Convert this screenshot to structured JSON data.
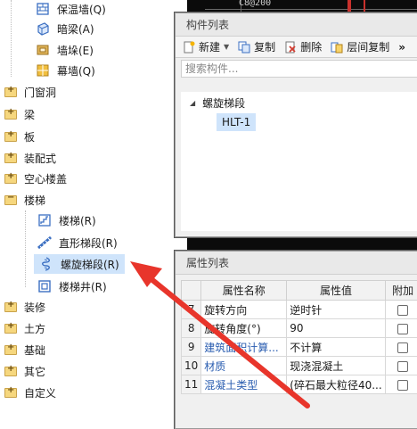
{
  "tree": {
    "items": [
      {
        "label": "保温墙(Q)",
        "kind": "child",
        "icon": "insulation-wall-icon"
      },
      {
        "label": "暗梁(A)",
        "kind": "child",
        "icon": "hidden-beam-icon"
      },
      {
        "label": "墙垛(E)",
        "kind": "child",
        "icon": "wall-pier-icon"
      },
      {
        "label": "幕墙(Q)",
        "kind": "child",
        "icon": "curtain-wall-icon"
      },
      {
        "label": "门窗洞",
        "kind": "folder"
      },
      {
        "label": "梁",
        "kind": "folder"
      },
      {
        "label": "板",
        "kind": "folder"
      },
      {
        "label": "装配式",
        "kind": "folder"
      },
      {
        "label": "空心楼盖",
        "kind": "folder"
      },
      {
        "label": "楼梯",
        "kind": "folder-open"
      },
      {
        "label": "楼梯(R)",
        "kind": "child",
        "icon": "stair-icon"
      },
      {
        "label": "直形梯段(R)",
        "kind": "child",
        "icon": "straight-flight-icon"
      },
      {
        "label": "螺旋梯段(R)",
        "kind": "child-selected",
        "icon": "spiral-flight-icon"
      },
      {
        "label": "楼梯井(R)",
        "kind": "child",
        "icon": "stairwell-icon"
      },
      {
        "label": "装修",
        "kind": "folder"
      },
      {
        "label": "土方",
        "kind": "folder"
      },
      {
        "label": "基础",
        "kind": "folder"
      },
      {
        "label": "其它",
        "kind": "folder"
      },
      {
        "label": "自定义",
        "kind": "folder"
      }
    ]
  },
  "cad": {
    "label": "C8@200"
  },
  "component_panel": {
    "title": "构件列表",
    "toolbar": {
      "new_label": "新建",
      "copy_label": "复制",
      "delete_label": "删除",
      "floor_copy_label": "层间复制",
      "more_label": "»"
    },
    "search_placeholder": "搜索构件...",
    "group_label": "螺旋梯段",
    "selected_item": "HLT-1"
  },
  "property_panel": {
    "title": "属性列表",
    "headers": {
      "name": "属性名称",
      "value": "属性值",
      "extra": "附加"
    },
    "rows": [
      {
        "num": "7",
        "name": "旋转方向",
        "value": "逆时针",
        "link": false
      },
      {
        "num": "8",
        "name": "旋转角度(°)",
        "value": "90",
        "link": false
      },
      {
        "num": "9",
        "name": "建筑面积计算...",
        "value": "不计算",
        "link": true
      },
      {
        "num": "10",
        "name": "材质",
        "value": "现浇混凝土",
        "link": true
      },
      {
        "num": "11",
        "name": "混凝土类型",
        "value": "(碎石最大粒径40...",
        "link": true
      }
    ]
  },
  "colors": {
    "accent_red": "#e8352b",
    "selected_bg": "#cfe4fb",
    "link_blue": "#2a5db0"
  }
}
